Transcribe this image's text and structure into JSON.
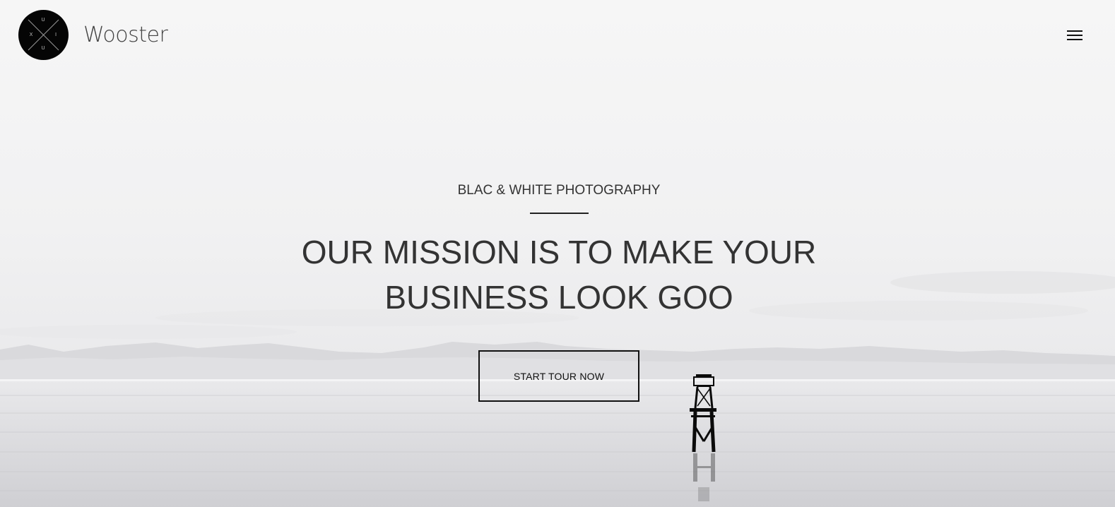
{
  "header": {
    "brand": "Wooster",
    "logo_letters": [
      "U",
      "X",
      "I",
      "U"
    ],
    "menu_icon": "hamburger-menu-icon"
  },
  "hero": {
    "subtitle": "BLAC & WHITE PHOTOGRAPHY",
    "headline_line1": "OUR MISSION IS TO MAKE YOUR",
    "headline_line2": "BUSINESS LOOK GOO",
    "cta_label": "START TOUR NOW"
  },
  "colors": {
    "text": "#333333",
    "logo_bg": "#050505",
    "button_border": "#111111"
  }
}
